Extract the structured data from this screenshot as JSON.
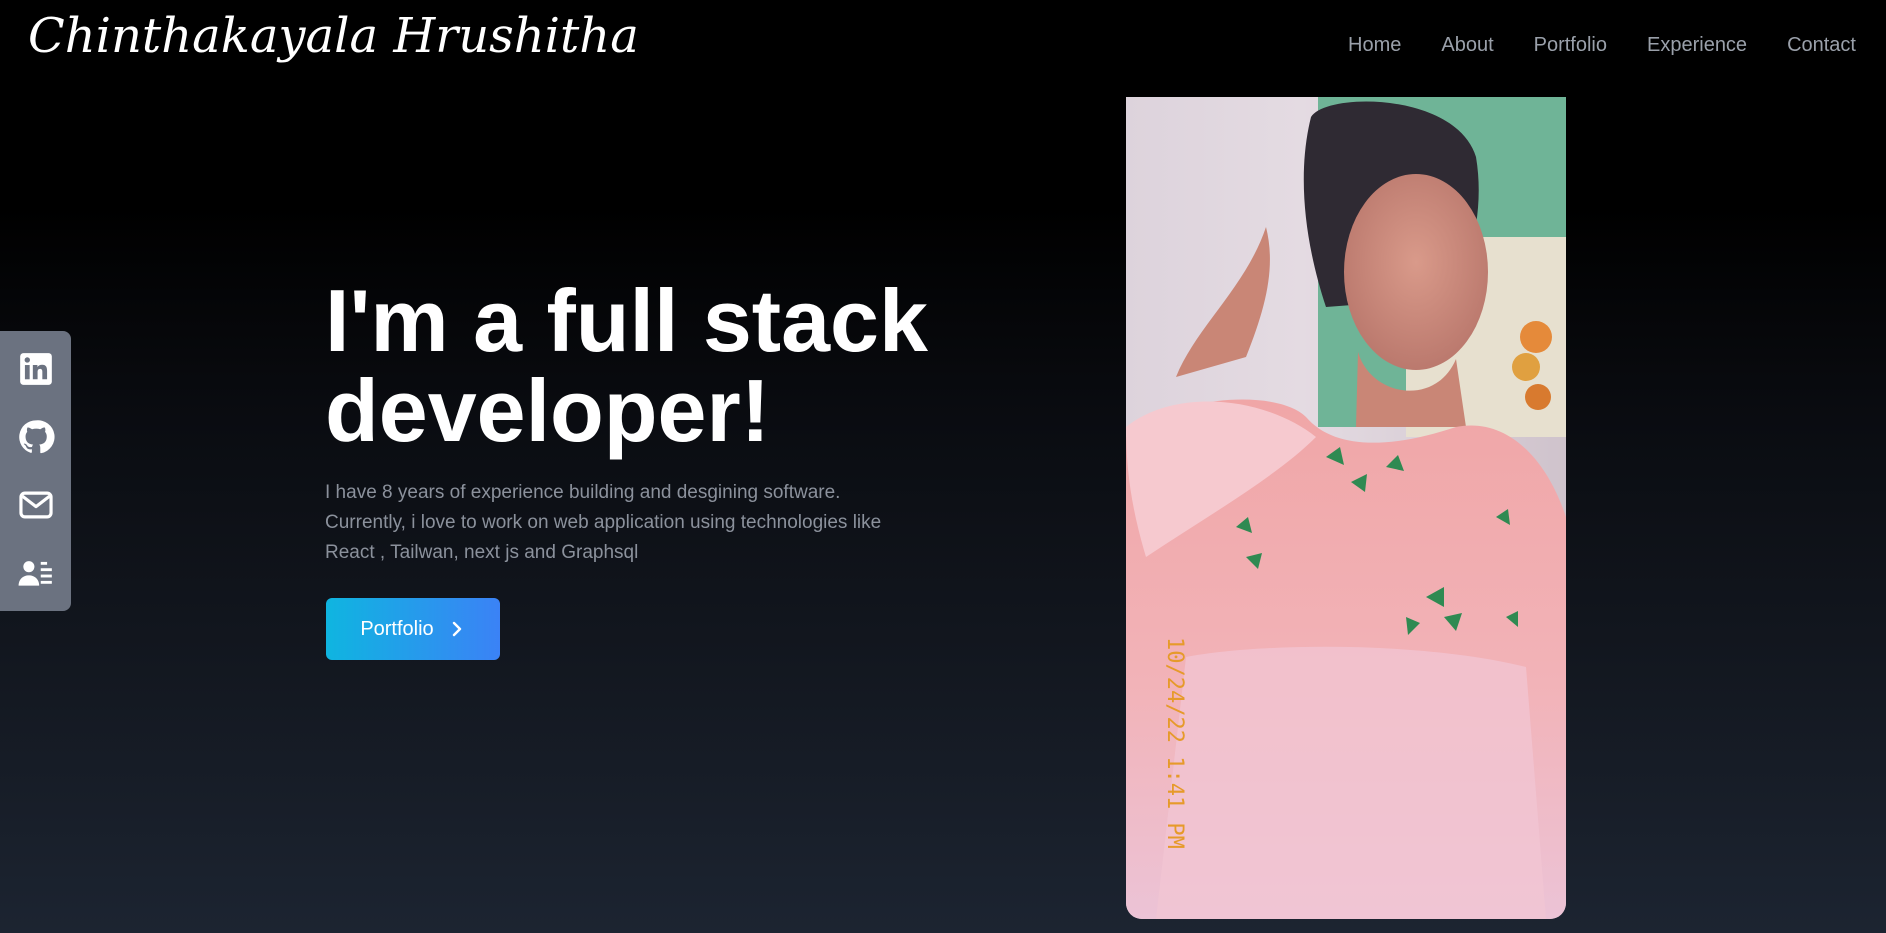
{
  "header": {
    "logo": "Chinthakayala Hrushitha",
    "nav": [
      {
        "label": "Home"
      },
      {
        "label": "About"
      },
      {
        "label": "Portfolio"
      },
      {
        "label": "Experience"
      },
      {
        "label": "Contact"
      }
    ]
  },
  "social": {
    "items": [
      {
        "icon": "linkedin-icon"
      },
      {
        "icon": "github-icon"
      },
      {
        "icon": "mail-icon"
      },
      {
        "icon": "resume-icon"
      }
    ]
  },
  "hero": {
    "title": "I'm a full stack developer!",
    "description": "I have 8 years of experience building and desgining software. Currently, i love to work on web application using technologies like React , Tailwan, next js and Graphsql",
    "button_label": "Portfolio"
  },
  "photo": {
    "timestamp": "10/24/22 1:41 PM"
  },
  "colors": {
    "accent_start": "#0fb5e0",
    "accent_end": "#3b82f6",
    "nav_text": "#9aa0aa",
    "body_text": "#8b919c",
    "sidebar_bg": "#6b7280"
  }
}
